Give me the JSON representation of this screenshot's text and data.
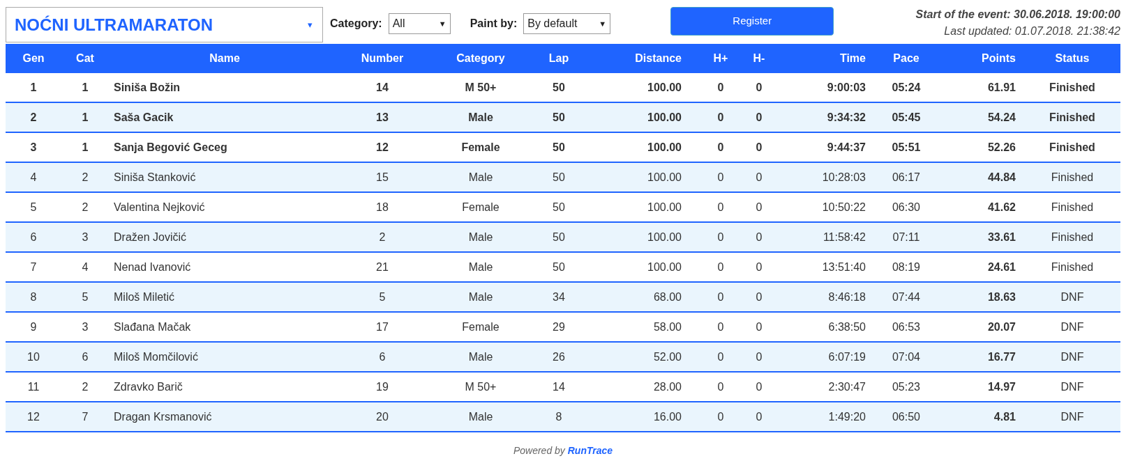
{
  "event_select": {
    "value": "NOĆNI ULTRAMARATON",
    "arrow": "▾"
  },
  "category_filter": {
    "label": "Category:",
    "value": "All",
    "arrow": "▼"
  },
  "paint_filter": {
    "label": "Paint by:",
    "value": "By default",
    "arrow": "▼"
  },
  "register_button": "Register",
  "event_start": "Start of the event: 30.06.2018. 19:00:00",
  "last_updated": "Last updated: 01.07.2018. 21:38:42",
  "table": {
    "columns": [
      "Gen",
      "Cat",
      "Name",
      "Number",
      "Category",
      "Lap",
      "Distance",
      "H+",
      "H-",
      "Time",
      "Pace",
      "Points",
      "Status"
    ],
    "rows": [
      {
        "highlighted": true,
        "cells": [
          "1",
          "1",
          "Siniša Božin",
          "14",
          "M 50+",
          "50",
          "100.00",
          "0",
          "0",
          "9:00:03",
          "05:24",
          "61.91",
          "Finished"
        ]
      },
      {
        "highlighted": true,
        "cells": [
          "2",
          "1",
          "Saša Gacik",
          "13",
          "Male",
          "50",
          "100.00",
          "0",
          "0",
          "9:34:32",
          "05:45",
          "54.24",
          "Finished"
        ]
      },
      {
        "highlighted": true,
        "cells": [
          "3",
          "1",
          "Sanja Begović Geceg",
          "12",
          "Female",
          "50",
          "100.00",
          "0",
          "0",
          "9:44:37",
          "05:51",
          "52.26",
          "Finished"
        ]
      },
      {
        "highlighted": false,
        "cells": [
          "4",
          "2",
          "Siniša Stanković",
          "15",
          "Male",
          "50",
          "100.00",
          "0",
          "0",
          "10:28:03",
          "06:17",
          "44.84",
          "Finished"
        ]
      },
      {
        "highlighted": false,
        "cells": [
          "5",
          "2",
          "Valentina Nejković",
          "18",
          "Female",
          "50",
          "100.00",
          "0",
          "0",
          "10:50:22",
          "06:30",
          "41.62",
          "Finished"
        ]
      },
      {
        "highlighted": false,
        "cells": [
          "6",
          "3",
          "Dražen Jovičić",
          "2",
          "Male",
          "50",
          "100.00",
          "0",
          "0",
          "11:58:42",
          "07:11",
          "33.61",
          "Finished"
        ]
      },
      {
        "highlighted": false,
        "cells": [
          "7",
          "4",
          "Nenad Ivanović",
          "21",
          "Male",
          "50",
          "100.00",
          "0",
          "0",
          "13:51:40",
          "08:19",
          "24.61",
          "Finished"
        ]
      },
      {
        "highlighted": false,
        "cells": [
          "8",
          "5",
          "Miloš Miletić",
          "5",
          "Male",
          "34",
          "68.00",
          "0",
          "0",
          "8:46:18",
          "07:44",
          "18.63",
          "DNF"
        ]
      },
      {
        "highlighted": false,
        "cells": [
          "9",
          "3",
          "Slađana Mačak",
          "17",
          "Female",
          "29",
          "58.00",
          "0",
          "0",
          "6:38:50",
          "06:53",
          "20.07",
          "DNF"
        ]
      },
      {
        "highlighted": false,
        "cells": [
          "10",
          "6",
          "Miloš Momčilović",
          "6",
          "Male",
          "26",
          "52.00",
          "0",
          "0",
          "6:07:19",
          "07:04",
          "16.77",
          "DNF"
        ]
      },
      {
        "highlighted": false,
        "cells": [
          "11",
          "2",
          "Zdravko Barič",
          "19",
          "M 50+",
          "14",
          "28.00",
          "0",
          "0",
          "2:30:47",
          "05:23",
          "14.97",
          "DNF"
        ]
      },
      {
        "highlighted": false,
        "cells": [
          "12",
          "7",
          "Dragan Krsmanović",
          "20",
          "Male",
          "8",
          "16.00",
          "0",
          "0",
          "1:49:20",
          "06:50",
          "4.81",
          "DNF"
        ]
      }
    ]
  },
  "footer": {
    "prefix": "Powered by",
    "brand": "RunTrace"
  }
}
